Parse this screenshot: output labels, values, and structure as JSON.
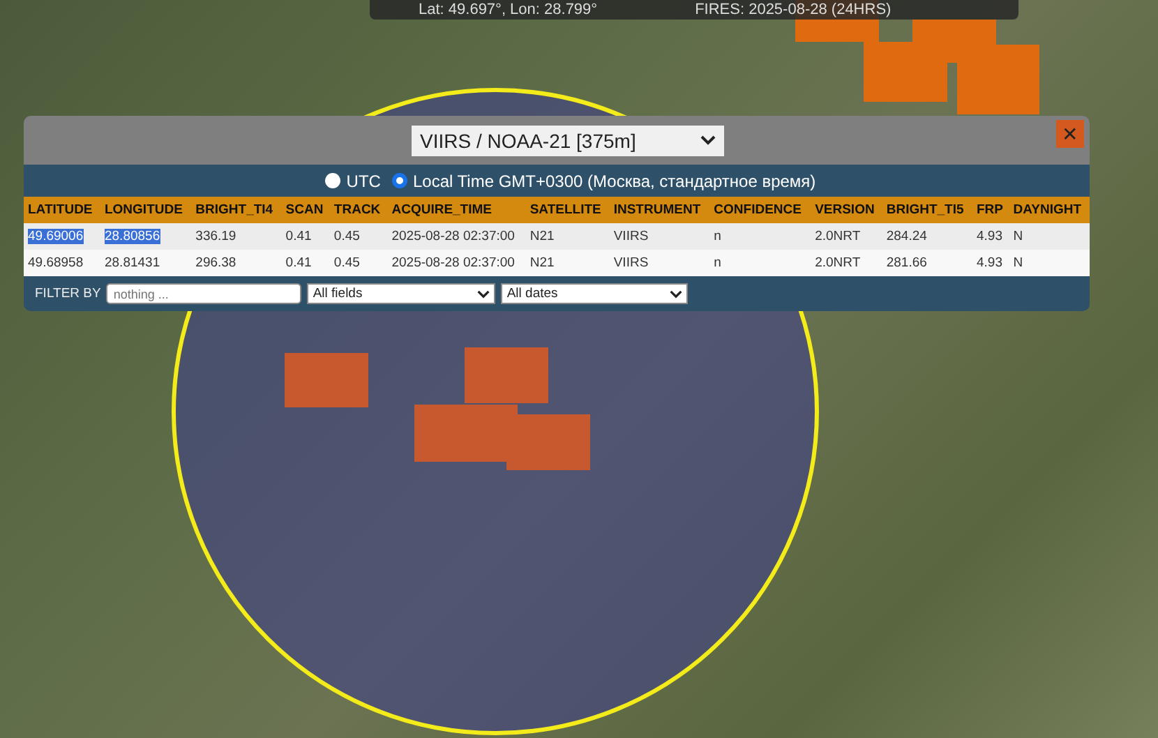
{
  "status_bar": {
    "coordinates": "Lat: 49.697°, Lon: 28.799°",
    "fires": "FIRES: 2025-08-28 (24HRS)"
  },
  "panel": {
    "source_select": "VIIRS / NOAA-21 [375m]",
    "close": "✕",
    "time_options": [
      {
        "label": "UTC",
        "selected": false
      },
      {
        "label": "Local Time GMT+0300 (Москва, стандартное время)",
        "selected": true
      }
    ],
    "table": {
      "columns": [
        "LATITUDE",
        "LONGITUDE",
        "BRIGHT_TI4",
        "SCAN",
        "TRACK",
        "ACQUIRE_TIME",
        "SATELLITE",
        "INSTRUMENT",
        "CONFIDENCE",
        "VERSION",
        "BRIGHT_TI5",
        "FRP",
        "DAYNIGHT"
      ],
      "rows": [
        {
          "cells": [
            {
              "text": "49.69006",
              "selected": true
            },
            {
              "text": "28.80856",
              "selected": true
            },
            {
              "text": "336.19",
              "selected": false
            },
            {
              "text": "0.41",
              "selected": false
            },
            {
              "text": "0.45",
              "selected": false
            },
            {
              "text": "2025-08-28 02:37:00",
              "selected": false
            },
            {
              "text": "N21",
              "selected": false
            },
            {
              "text": "VIIRS",
              "selected": false
            },
            {
              "text": "n",
              "selected": false
            },
            {
              "text": "2.0NRT",
              "selected": false
            },
            {
              "text": "284.24",
              "selected": false
            },
            {
              "text": "4.93",
              "selected": false
            },
            {
              "text": "N",
              "selected": false
            }
          ]
        },
        {
          "cells": [
            {
              "text": "49.68958",
              "selected": false
            },
            {
              "text": "28.81431",
              "selected": false
            },
            {
              "text": "296.38",
              "selected": false
            },
            {
              "text": "0.41",
              "selected": false
            },
            {
              "text": "0.45",
              "selected": false
            },
            {
              "text": "2025-08-28 02:37:00",
              "selected": false
            },
            {
              "text": "N21",
              "selected": false
            },
            {
              "text": "VIIRS",
              "selected": false
            },
            {
              "text": "n",
              "selected": false
            },
            {
              "text": "2.0NRT",
              "selected": false
            },
            {
              "text": "281.66",
              "selected": false
            },
            {
              "text": "4.93",
              "selected": false
            },
            {
              "text": "N",
              "selected": false
            }
          ]
        }
      ]
    },
    "filter": {
      "label": "FILTER BY",
      "placeholder": "nothing ...",
      "field_select": "All fields",
      "date_select": "All dates"
    }
  }
}
